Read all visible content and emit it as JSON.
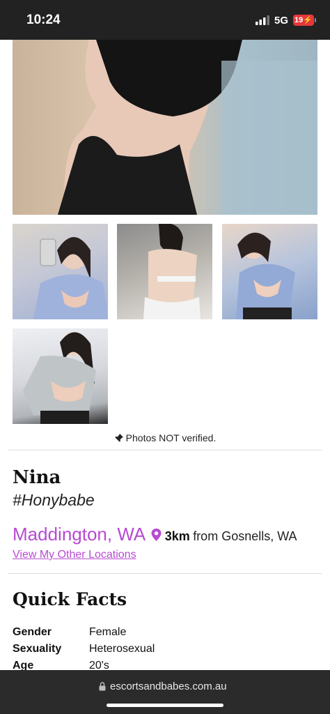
{
  "status_bar": {
    "time": "10:24",
    "network": "5G",
    "battery": "19"
  },
  "photos": {
    "verify_note": "Photos NOT verified."
  },
  "profile": {
    "name": "Nina",
    "tagline": "#Honybabe",
    "location": "Maddington, WA",
    "distance": "3km",
    "from_text": "from Gosnells, WA",
    "other_locations_label": "View My Other Locations"
  },
  "quick_facts": {
    "title": "Quick Facts",
    "items": [
      {
        "label": "Gender",
        "value": "Female"
      },
      {
        "label": "Sexuality",
        "value": "Heterosexual"
      },
      {
        "label": "Age",
        "value": "20's"
      }
    ]
  },
  "browser": {
    "url": "escortsandbabes.com.au"
  },
  "colors": {
    "accent": "#b84ad3",
    "status_bar": "#222222",
    "battery": "#e5383b"
  }
}
